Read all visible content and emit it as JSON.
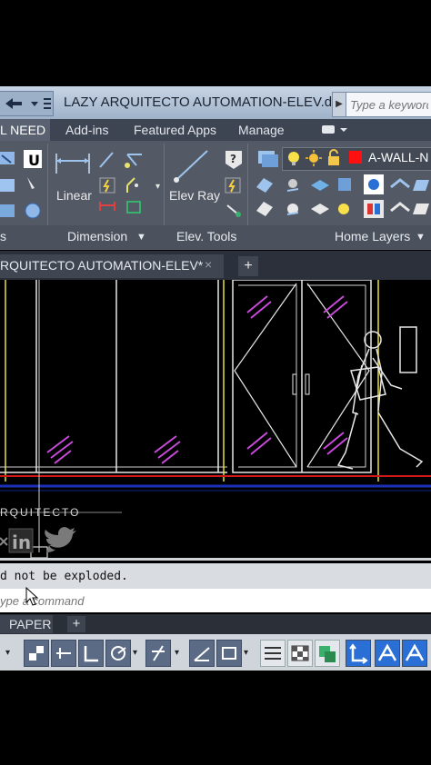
{
  "window": {
    "title": "LAZY ARQUITECTO AUTOMATION-ELEV.d...",
    "search_placeholder": "Type a keyword"
  },
  "ribbon_tabs": {
    "active": "L NEED",
    "items": [
      "Add-ins",
      "Featured Apps",
      "Manage"
    ]
  },
  "ribbon": {
    "linear_label": "Linear",
    "elev_ray_label": "Elev Ray",
    "layer_name": "A-WALL-N",
    "layer_color": "#ff1010",
    "panels": {
      "left_title": "s",
      "dimension": "Dimension",
      "elev_tools": "Elev. Tools",
      "home_layers": "Home Layers"
    }
  },
  "document_tab": {
    "title": "RQUITECTO AUTOMATION-ELEV*",
    "close_glyph": "×",
    "add_glyph": "+"
  },
  "drawing": {
    "watermark": "RQUITECTO"
  },
  "command": {
    "history": "d not be exploded.",
    "input_placeholder": "ype a command"
  },
  "layout_tabs": {
    "paper": "PAPER",
    "add_glyph": "+"
  }
}
